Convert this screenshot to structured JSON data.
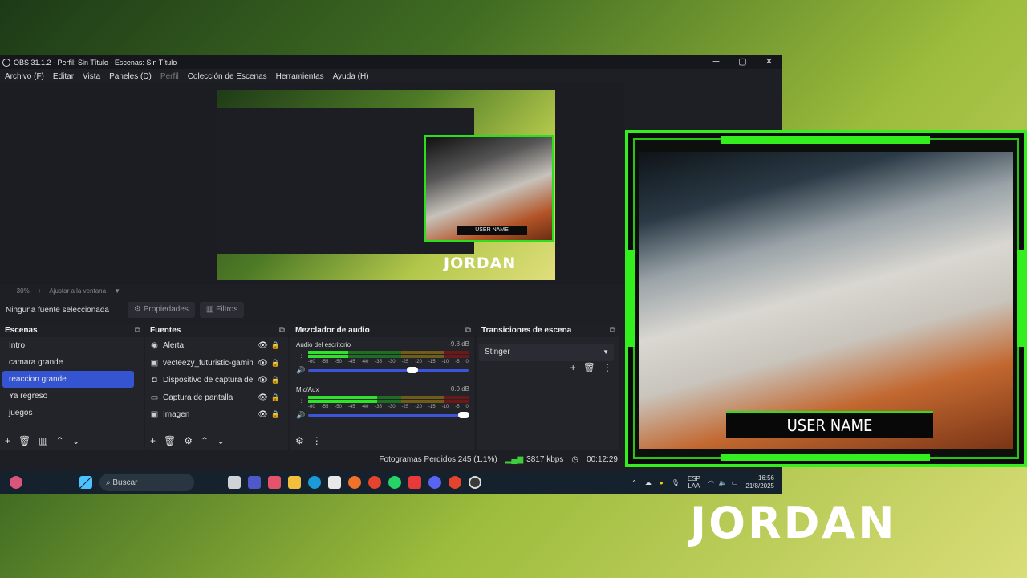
{
  "window": {
    "title": "OBS 31.1.2 - Perfil: Sin Título - Escenas: Sin Título",
    "controls": {
      "minimize": "─",
      "maximize": "▢",
      "close": "✕"
    }
  },
  "menu": [
    "Archivo (F)",
    "Editar",
    "Vista",
    "Paneles (D)",
    "Perfil",
    "Colección de Escenas",
    "Herramientas",
    "Ayuda (H)"
  ],
  "preview": {
    "logo": "JORDAN",
    "cam_name": "USER NAME",
    "zoom": "30%",
    "zoom_minus": "−",
    "zoom_plus": "+",
    "fit_label": "Ajustar a la ventana",
    "fit_arrow": "▼"
  },
  "properties_bar": {
    "no_source": "Ninguna fuente seleccionada",
    "properties": "Propiedades",
    "filters": "Filtros"
  },
  "scenes": {
    "title": "Escenas",
    "items": [
      "Intro",
      "camara grande",
      "reaccion grande",
      "Ya regreso",
      "juegos"
    ],
    "selected_index": 2
  },
  "sources": {
    "title": "Fuentes",
    "items": [
      {
        "icon": "alert-icon",
        "label": "Alerta"
      },
      {
        "icon": "image-icon",
        "label": "vecteezy_futuristic-gaming"
      },
      {
        "icon": "camera-icon",
        "label": "Dispositivo de captura de vídeo"
      },
      {
        "icon": "monitor-icon",
        "label": "Captura de pantalla"
      },
      {
        "icon": "image-icon",
        "label": "Imagen"
      }
    ]
  },
  "mixer": {
    "title": "Mezclador de audio",
    "channels": [
      {
        "name": "Audio del escritorio",
        "db": "-9.8 dB",
        "level": 0.25,
        "fader": 0.65
      },
      {
        "name": "Mic/Aux",
        "db": "0.0 dB",
        "level": 0.43,
        "fader": 0.97
      }
    ],
    "scale": [
      "-60",
      "-55",
      "-50",
      "-45",
      "-40",
      "-35",
      "-30",
      "-25",
      "-20",
      "-15",
      "-10",
      "-5",
      "0"
    ]
  },
  "transitions": {
    "title": "Transiciones de escena",
    "selected": "Stinger"
  },
  "status": {
    "dropped": "Fotogramas Perdidos 245 (1.1%)",
    "bitrate": "3817 kbps",
    "time": "00:12:29"
  },
  "taskbar": {
    "search": "Buscar",
    "lang_1": "ESP",
    "lang_2": "LAA",
    "time": "16:56",
    "date": "21/8/2025"
  },
  "overlay": {
    "cam_name": "USER NAME",
    "logo": "JORDAN"
  },
  "colors": {
    "accent_green": "#33ef1d",
    "selection_blue": "#3554d1",
    "obs_bg": "#1e1f25"
  }
}
